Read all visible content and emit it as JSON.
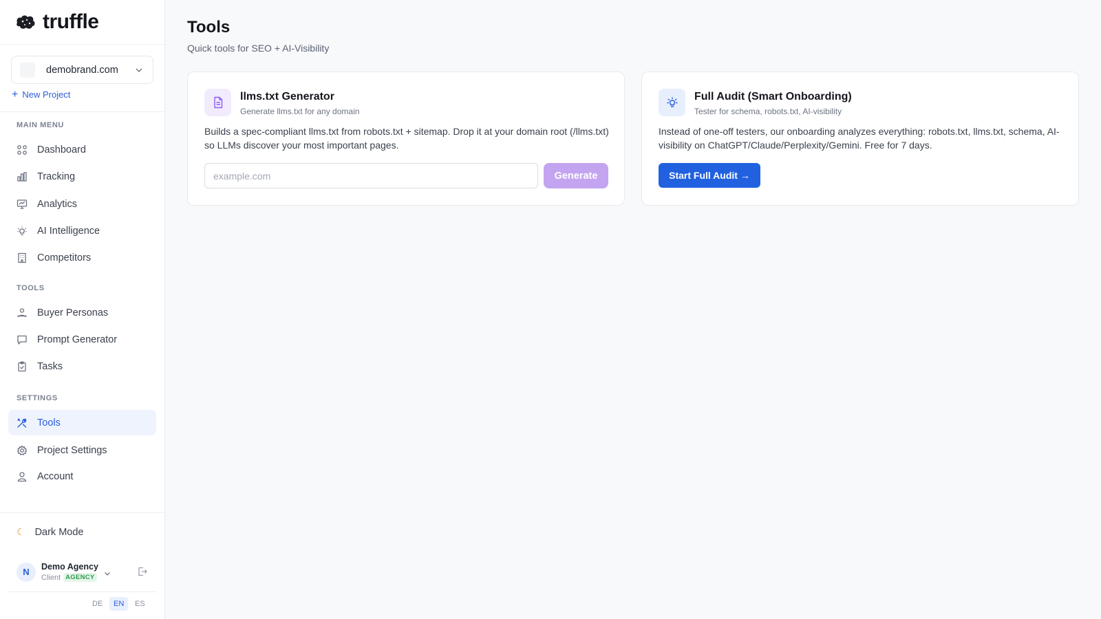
{
  "app": {
    "logo_text": "truffle"
  },
  "sidebar": {
    "project": {
      "name": "demobrand.com"
    },
    "new_project_label": "New Project",
    "sections": {
      "main_menu": "MAIN MENU",
      "tools": "TOOLS",
      "settings": "SETTINGS"
    },
    "items": [
      {
        "label": "Dashboard",
        "icon": "grid-icon"
      },
      {
        "label": "Tracking",
        "icon": "bar-chart-icon"
      },
      {
        "label": "Analytics",
        "icon": "presentation-chart-icon"
      },
      {
        "label": "AI Intelligence",
        "icon": "lightbulb-icon"
      },
      {
        "label": "Competitors",
        "icon": "building-icon"
      },
      {
        "label": "Buyer Personas",
        "icon": "users-icon"
      },
      {
        "label": "Prompt Generator",
        "icon": "message-icon"
      },
      {
        "label": "Tasks",
        "icon": "clipboard-check-icon"
      },
      {
        "label": "Tools",
        "icon": "tools-icon",
        "active": true
      },
      {
        "label": "Project Settings",
        "icon": "gear-icon"
      },
      {
        "label": "Account",
        "icon": "user-icon"
      }
    ],
    "dark_mode_label": "Dark Mode",
    "user": {
      "initial": "N",
      "name": "Demo Agency",
      "role": "Client",
      "badge": "AGENCY"
    },
    "languages": [
      {
        "code": "DE",
        "active": false
      },
      {
        "code": "EN",
        "active": true
      },
      {
        "code": "ES",
        "active": false
      }
    ]
  },
  "main": {
    "title": "Tools",
    "subtitle": "Quick tools for SEO + AI-Visibility",
    "cards": [
      {
        "title": "llms.txt Generator",
        "subtitle": "Generate llms.txt for any domain",
        "description": "Builds a spec-compliant llms.txt from robots.txt + sitemap. Drop it at your domain root (/llms.txt) so LLMs discover your most important pages.",
        "input_placeholder": "example.com",
        "button_label": "Generate",
        "icon": "document-icon",
        "accent": "#8b5cf6"
      },
      {
        "title": "Full Audit (Smart Onboarding)",
        "subtitle": "Tester for schema, robots.txt, AI-visibility",
        "description": "Instead of one-off testers, our onboarding analyzes everything: robots.txt, llms.txt, schema, AI-visibility on ChatGPT/Claude/Perplexity/Gemini. Free for 7 days.",
        "button_label": "Start Full Audit →",
        "icon": "lightbulb-icon",
        "accent": "#2161e0"
      }
    ]
  }
}
